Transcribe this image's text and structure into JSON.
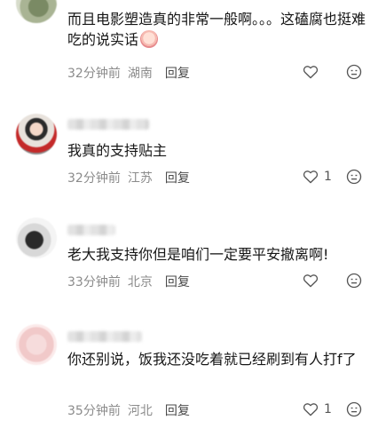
{
  "comments": [
    {
      "text": "而且电影塑造真的非常一般啊。。。这磕腐也挺难吃的说实话",
      "time": "32分钟前",
      "location": "湖南",
      "reply_label": "回复",
      "likes": ""
    },
    {
      "text": "我真的支持贴主",
      "time": "32分钟前",
      "location": "江苏",
      "reply_label": "回复",
      "likes": "1"
    },
    {
      "text": "老大我支持你但是咱们一定要平安撤离啊!",
      "time": "33分钟前",
      "location": "北京",
      "reply_label": "回复",
      "likes": ""
    },
    {
      "text": "你还别说，饭我还没吃着就已经刷到有人打f了",
      "time": "35分钟前",
      "location": "河北",
      "reply_label": "回复",
      "likes": "1"
    }
  ],
  "icons": {
    "like": "heart-outline-icon",
    "dislike": "dislike-face-icon",
    "inline_emoji": "crying-face-emoji"
  },
  "colors": {
    "meta_text": "#8b8b8b",
    "body_text": "#161616",
    "icon": "#555555"
  }
}
